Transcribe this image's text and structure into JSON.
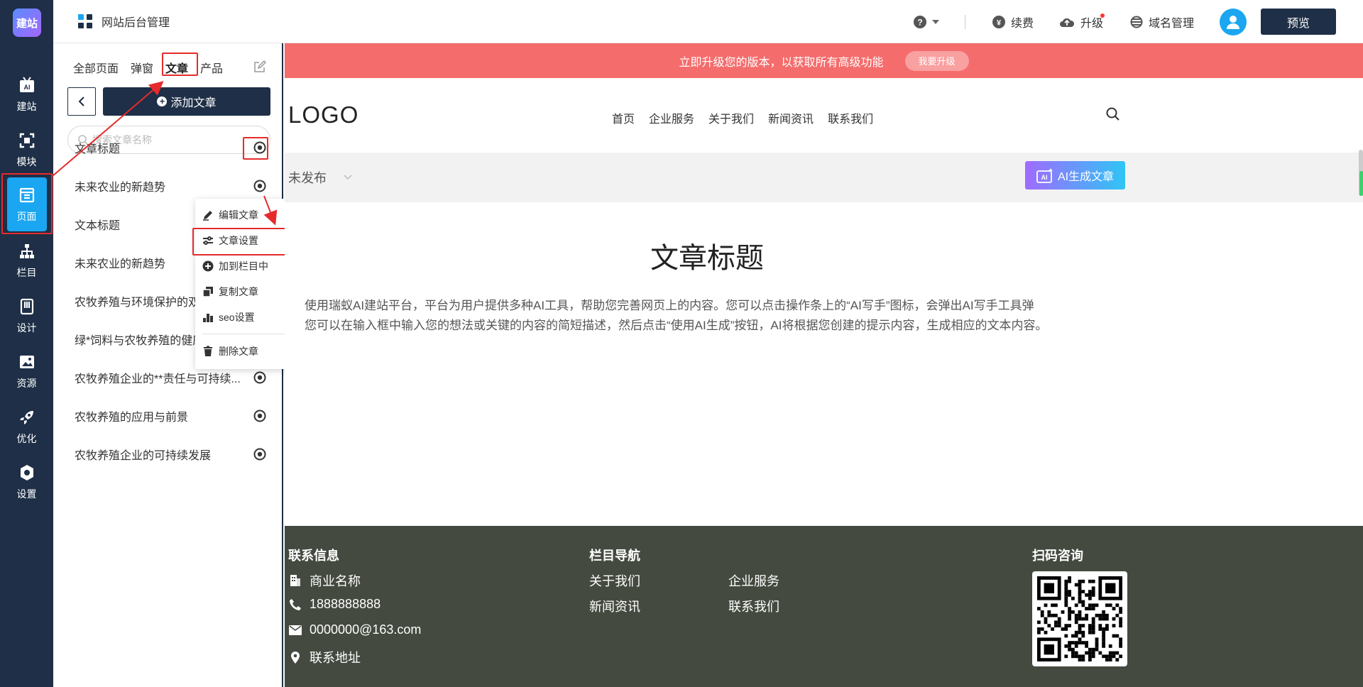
{
  "nav": {
    "logo": "建站",
    "items": [
      {
        "label": "建站",
        "icon": "ai-icon"
      },
      {
        "label": "模块",
        "icon": "module-icon"
      },
      {
        "label": "页面",
        "icon": "page-icon"
      },
      {
        "label": "栏目",
        "icon": "sitemap-icon"
      },
      {
        "label": "设计",
        "icon": "design-icon"
      },
      {
        "label": "资源",
        "icon": "image-icon"
      },
      {
        "label": "优化",
        "icon": "rocket-icon"
      },
      {
        "label": "设置",
        "icon": "gear-icon"
      }
    ]
  },
  "topbar": {
    "title": "网站后台管理",
    "help": "?",
    "renew": "续费",
    "upgrade": "升级",
    "domain": "域名管理",
    "preview": "预览"
  },
  "sidebar": {
    "tabs": [
      "全部页面",
      "弹窗",
      "文章",
      "产品"
    ],
    "active_tab": "文章",
    "add_button": "添加文章",
    "search_placeholder": "搜索文章名称",
    "articles": [
      "文章标题",
      "未来农业的新趋势",
      "文本标题",
      "未来农业的新趋势",
      "农牧养殖与环境保护的双",
      "绿*饲料与农牧养殖的健康发展",
      "农牧养殖企业的**责任与可持续...",
      "农牧养殖的应用与前景",
      "农牧养殖企业的可持续发展"
    ]
  },
  "menu": {
    "items": [
      {
        "label": "编辑文章",
        "icon": "pencil-icon"
      },
      {
        "label": "文章设置",
        "icon": "sliders-icon"
      },
      {
        "label": "加到栏目中",
        "icon": "plus-circle-icon"
      },
      {
        "label": "复制文章",
        "icon": "copy-icon"
      },
      {
        "label": "seo设置",
        "icon": "bar-chart-icon"
      },
      {
        "label": "删除文章",
        "icon": "trash-icon"
      }
    ]
  },
  "canvas": {
    "banner": "立即升级您的版本，以获取所有高级功能",
    "banner_button": "我要升级",
    "logo": "LOGO",
    "site_nav": [
      "首页",
      "企业服务",
      "关于我们",
      "新闻资讯",
      "联系我们"
    ],
    "status": "未发布",
    "ai_button": "AI生成文章",
    "article_title": "文章标题",
    "article_line1": "使用瑞蚁AI建站平台，平台为用户提供多种AI工具，帮助您完善网页上的内容。您可以点击操作条上的“AI写手”图标，会弹出AI写手工具弹",
    "article_line2": "您可以在输入框中输入您的想法或关键的内容的简短描述，然后点击“使用AI生成”按钮，AI将根据您创建的提示内容，生成相应的文本内容。"
  },
  "footer": {
    "contact_title": "联系信息",
    "contact": [
      "商业名称",
      "1888888888",
      "0000000@163.com",
      "联系地址"
    ],
    "nav_title": "栏目导航",
    "nav_links": [
      "关于我们",
      "企业服务",
      "新闻资讯",
      "联系我们"
    ],
    "qr_title": "扫码咨询"
  },
  "colors": {
    "nav_bg": "#1e2f47",
    "accent": "#1aa6f0",
    "banner": "#f56c6c",
    "footer": "#444a3f",
    "highlight": "#e52b2b"
  }
}
